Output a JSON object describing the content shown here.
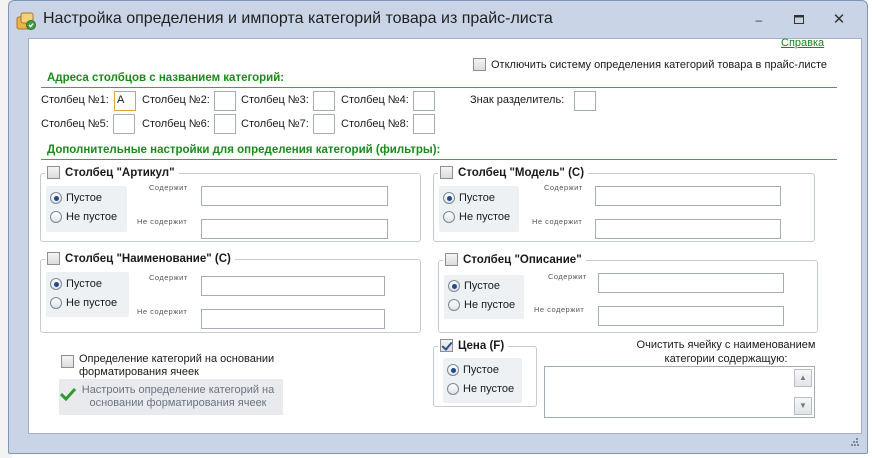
{
  "window": {
    "title": "Настройка определения и импорта категорий товара из прайс-листа",
    "minimize_icon": "minimize-icon",
    "maximize_icon": "maximize-icon",
    "close_icon": "close-icon"
  },
  "help_link": "Справка",
  "disable_system_label": "Отключить систему определения категорий товара в прайс-листе",
  "addresses": {
    "heading": "Адреса столбцов с названием категорий:",
    "col1": "Столбец №1:",
    "col1_value": "A",
    "col2": "Столбец №2:",
    "col3": "Столбец №3:",
    "col4": "Столбец №4:",
    "col5": "Столбец №5:",
    "col6": "Столбец №6:",
    "col7": "Столбец №7:",
    "col8": "Столбец №8:",
    "separator": "Знак разделитель:"
  },
  "filters": {
    "heading": "Дополнительные настройки для определения категорий (фильтры):",
    "empty": "Пустое",
    "not_empty": "Не пустое",
    "contains": "Содержит",
    "not_contains": "Не содержит",
    "article": "Столбец \"Артикул\"",
    "model": "Столбец \"Модель\" (C)",
    "name": "Столбец \"Наименование\" (C)",
    "description": "Столбец \"Описание\"",
    "price": "Цена (F)"
  },
  "formatting": {
    "checkbox_label": "Определение категорий на основании форматирования ячеек",
    "button_label": "Настроить определение категорий на основании форматирования ячеек"
  },
  "clear_cell_label": "Очистить ячейку с наименованием категории содержащую:",
  "colors": {
    "accent_green": "#1c8a1c",
    "window_frame": "#c9d5e6"
  }
}
